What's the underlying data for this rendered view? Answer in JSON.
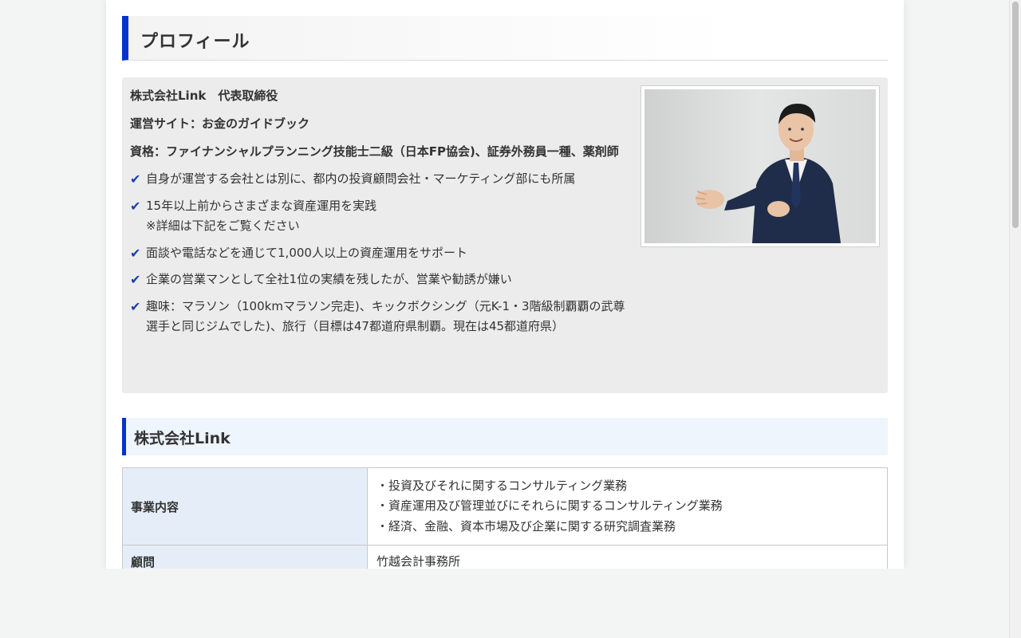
{
  "profile": {
    "heading": "プロフィール",
    "title_line": "株式会社Link　代表取締役",
    "site_line": "運営サイト：お金のガイドブック",
    "qualification_line": "資格：ファイナンシャルプランニング技能士二級（日本FP協会)、証券外務員一種、薬剤師",
    "check_icon": "✔",
    "points": [
      {
        "text": "自身が運営する会社とは別に、都内の投資顧問会社・マーケティング部にも所属"
      },
      {
        "text": "15年以上前からさまざまな資産運用を実践",
        "note": "※詳細は下記をご覧ください"
      },
      {
        "text": "面談や電話などを通じて1,000人以上の資産運用をサポート"
      },
      {
        "text": "企業の営業マンとして全社1位の実績を残したが、営業や勧誘が嫌い"
      },
      {
        "text": "趣味：マラソン（100kmマラソン完走)、キックボクシング（元K-1・3階級制覇覇の武尊選手と同じジムでした)、旅行（目標は47都道府県制覇。現在は45都道府県）"
      }
    ],
    "photo": "portrait-photo"
  },
  "company": {
    "heading": "株式会社Link",
    "rows": [
      {
        "label": "事業内容",
        "lines": [
          "・投資及びそれに関するコンサルティング業務",
          "・資産運用及び管理並びにそれらに関するコンサルティング業務",
          "・経済、金融、資本市場及び企業に関する研究調査業務"
        ]
      },
      {
        "label": "顧問",
        "lines": [
          "竹越会計事務所"
        ]
      }
    ]
  },
  "colors": {
    "accent": "#0033cc",
    "check": "#1a3fb0",
    "table_header_bg": "#e5eef8",
    "heading_bg": "#eef5fd"
  }
}
